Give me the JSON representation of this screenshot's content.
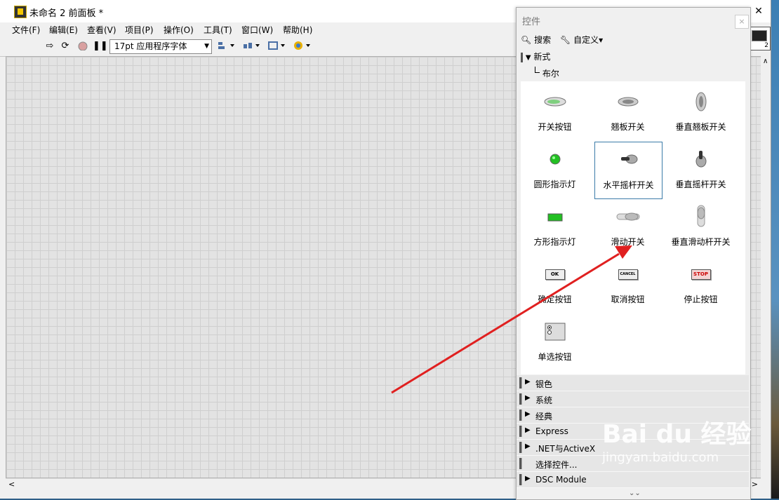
{
  "window": {
    "title": "未命名 2 前面板 *",
    "minimize_label": "—",
    "maximize_label": "▢",
    "close_label": "✕"
  },
  "menubar": [
    "文件(F)",
    "编辑(E)",
    "查看(V)",
    "项目(P)",
    "操作(O)",
    "工具(T)",
    "窗口(W)",
    "帮助(H)"
  ],
  "toolbar": {
    "run_icon": "run-arrow-icon",
    "font_select": "17pt 应用程序字体"
  },
  "palette_number": "2",
  "controls_palette": {
    "title": "控件",
    "close_label": "×",
    "search_label": "搜索",
    "customize_label": "自定义▾",
    "category": "新式",
    "subcategory": "布尔",
    "items": [
      {
        "label": "开关按钮",
        "icon": "toggle-button-icon"
      },
      {
        "label": "翘板开关",
        "icon": "rocker-switch-icon"
      },
      {
        "label": "垂直翘板开关",
        "icon": "vertical-rocker-icon"
      },
      {
        "label": "圆形指示灯",
        "icon": "round-led-icon"
      },
      {
        "label": "水平摇杆开关",
        "icon": "horizontal-toggle-icon",
        "selected": true
      },
      {
        "label": "垂直摇杆开关",
        "icon": "vertical-toggle-icon"
      },
      {
        "label": "方形指示灯",
        "icon": "square-led-icon"
      },
      {
        "label": "滑动开关",
        "icon": "slide-switch-icon"
      },
      {
        "label": "垂直滑动杆开关",
        "icon": "vertical-slide-icon"
      },
      {
        "label": "确定按钮",
        "icon": "ok-button-icon",
        "text": "OK"
      },
      {
        "label": "取消按钮",
        "icon": "cancel-button-icon",
        "text": "CANCEL"
      },
      {
        "label": "停止按钮",
        "icon": "stop-button-icon",
        "text": "STOP"
      },
      {
        "label": "单选按钮",
        "icon": "radio-buttons-icon"
      }
    ],
    "categories": [
      "银色",
      "系统",
      "经典",
      "Express",
      ".NET与ActiveX",
      "选择控件...",
      "DSC Module"
    ]
  },
  "watermark": {
    "brand": "Bai du 经验",
    "url": "jingyan.baidu.com"
  },
  "colors": {
    "arrow": "#e02020",
    "selection": "#3b7ba8",
    "led_green": "#22c022"
  }
}
